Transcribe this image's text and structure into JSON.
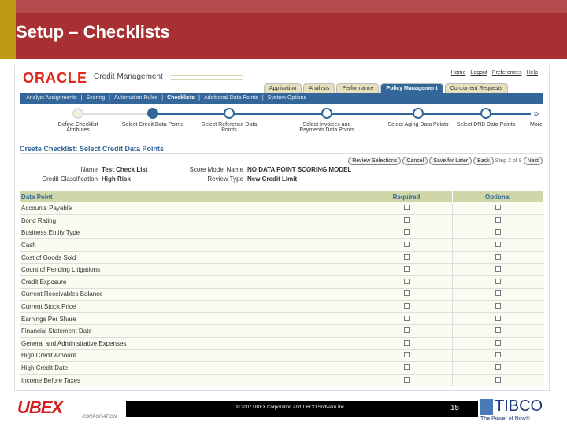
{
  "slide": {
    "title": "Setup – Checklists",
    "copyright": "© 2007 UBEX Corporation and TIBCO Software Inc",
    "page": "15"
  },
  "logos": {
    "ubex": "UBEX",
    "ubex_sub": "CORPORATION",
    "tibco": "TIBCO",
    "tibco_tag": "The Power of Now®"
  },
  "app": {
    "brand": "ORACLE",
    "name": "Credit Management",
    "links": [
      "Home",
      "Logout",
      "Preferences",
      "Help"
    ],
    "tabs": [
      "Application",
      "Analysis",
      "Performance",
      "Policy Management",
      "Concurrent Requests"
    ],
    "subnav": [
      "Analyst Assignments",
      "Scoring",
      "Automation Rules",
      "Checklists",
      "Additional Data Points",
      "System Options"
    ]
  },
  "train": {
    "steps": [
      "Define Checklist Attributes",
      "Select Credit Data Points",
      "Select Reference Data Points",
      "Select Invoices and Payments Data Points",
      "Select Aging Data Points",
      "Select DNB Data Points"
    ],
    "more": "More",
    "current": 1
  },
  "page": {
    "title": "Create Checklist: Select Credit Data Points",
    "buttons": {
      "review": "Review Selections",
      "cancel": "Cancel",
      "save": "Save for Later",
      "back": "Back",
      "step": "Step 2 of 8",
      "next": "Next"
    },
    "fields": {
      "name_label": "Name",
      "name": "Test Check List",
      "model_label": "Score Model Name",
      "model": "NO DATA POINT SCORING MODEL",
      "class_label": "Credit Classification",
      "class": "High Risk",
      "review_label": "Review Type",
      "review": "New Credit Limit"
    }
  },
  "table": {
    "headers": [
      "Data Point",
      "Required",
      "Optional"
    ],
    "rows": [
      "Accounts Payable",
      "Bond Rating",
      "Business Entity Type",
      "Cash",
      "Cost of Goods Sold",
      "Count of Pending Litigations",
      "Credit Exposure",
      "Current Receivables Balance",
      "Current Stock Price",
      "Earnings Per Share",
      "Financial Statement Date",
      "General and Administrative Expenses",
      "High Credit Amount",
      "High Credit Date",
      "Income Before Taxes"
    ]
  }
}
